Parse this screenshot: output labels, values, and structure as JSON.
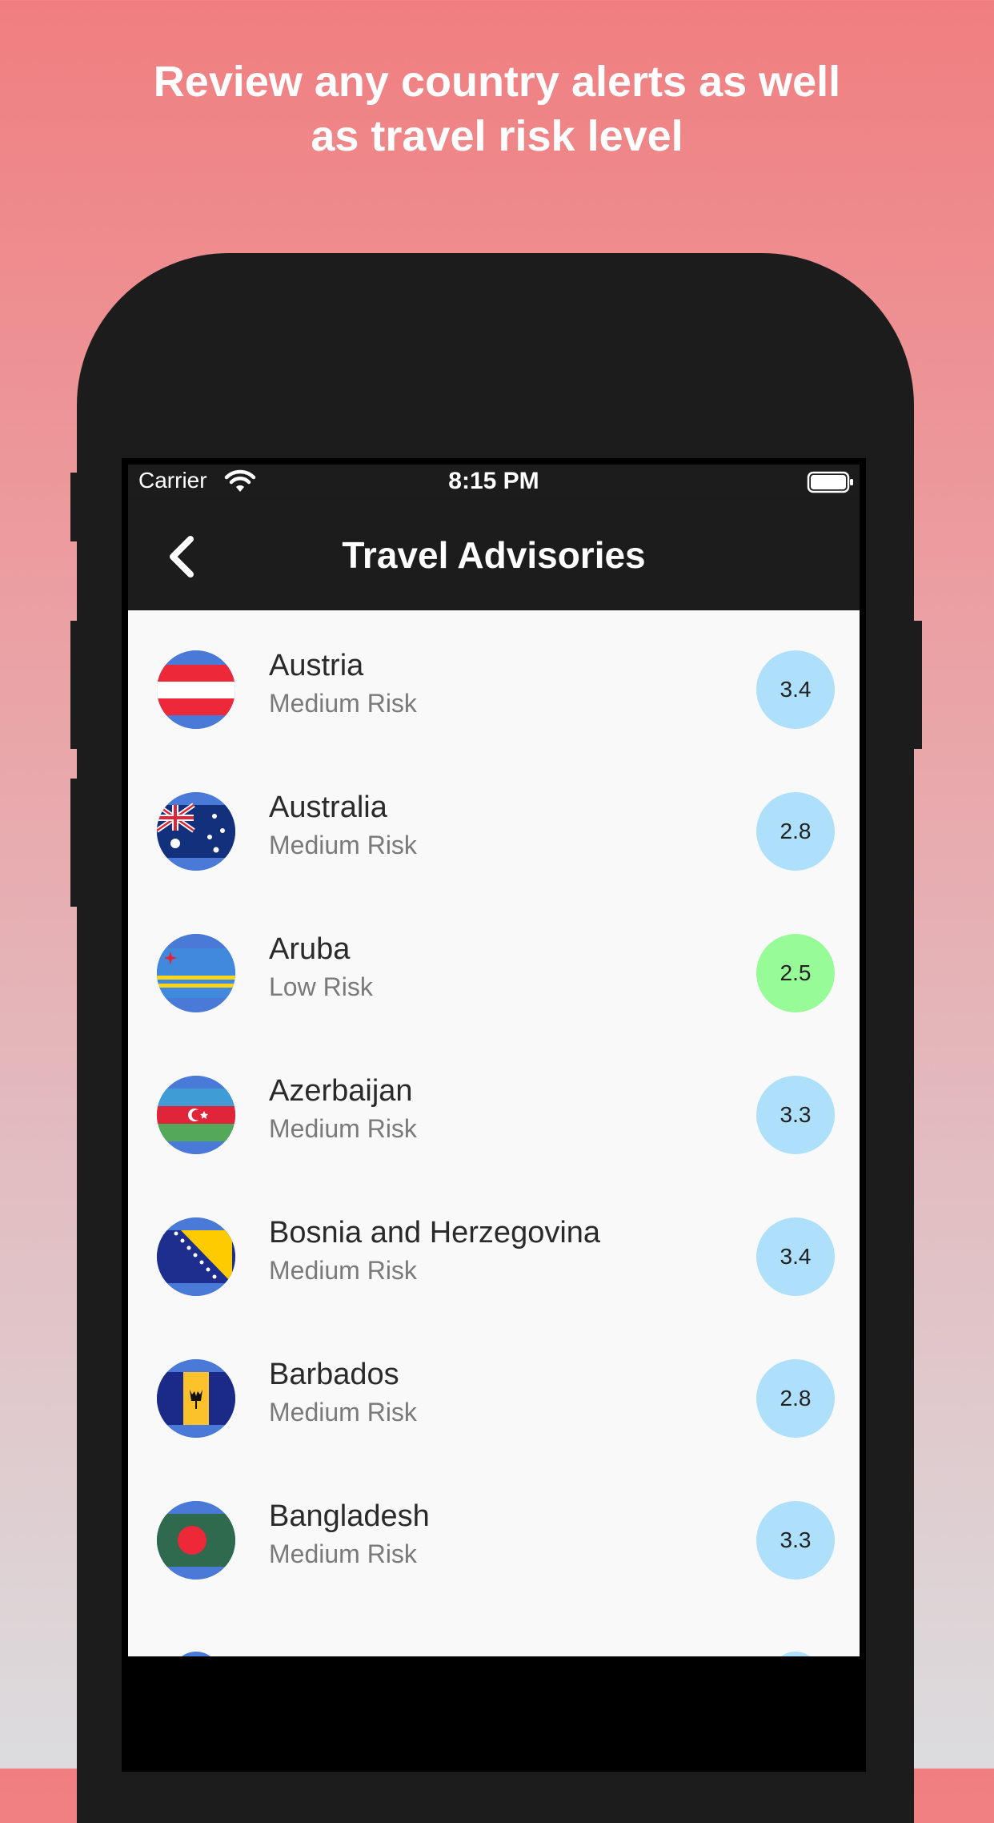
{
  "headline": {
    "line1": "Review any country alerts as well",
    "line2": "as travel risk level"
  },
  "status_bar": {
    "carrier": "Carrier",
    "time": "8:15 PM",
    "wifi_icon": "wifi-icon",
    "battery_icon": "battery-icon"
  },
  "nav": {
    "title": "Travel Advisories",
    "back_icon": "chevron-left-icon"
  },
  "colors": {
    "medium_risk_badge": "#aee0fb",
    "low_risk_badge": "#97fb98",
    "nav_background": "#1c1c1c"
  },
  "countries": [
    {
      "name": "Austria",
      "risk": "Medium Risk",
      "score": "3.4",
      "level": "medium",
      "flag_icon": "austria-flag-icon"
    },
    {
      "name": "Australia",
      "risk": "Medium Risk",
      "score": "2.8",
      "level": "medium",
      "flag_icon": "australia-flag-icon"
    },
    {
      "name": "Aruba",
      "risk": "Low Risk",
      "score": "2.5",
      "level": "low",
      "flag_icon": "aruba-flag-icon"
    },
    {
      "name": "Azerbaijan",
      "risk": "Medium Risk",
      "score": "3.3",
      "level": "medium",
      "flag_icon": "azerbaijan-flag-icon"
    },
    {
      "name": "Bosnia and Herzegovina",
      "risk": "Medium Risk",
      "score": "3.4",
      "level": "medium",
      "flag_icon": "bosnia-flag-icon"
    },
    {
      "name": "Barbados",
      "risk": "Medium Risk",
      "score": "2.8",
      "level": "medium",
      "flag_icon": "barbados-flag-icon"
    },
    {
      "name": "Bangladesh",
      "risk": "Medium Risk",
      "score": "3.3",
      "level": "medium",
      "flag_icon": "bangladesh-flag-icon"
    }
  ]
}
